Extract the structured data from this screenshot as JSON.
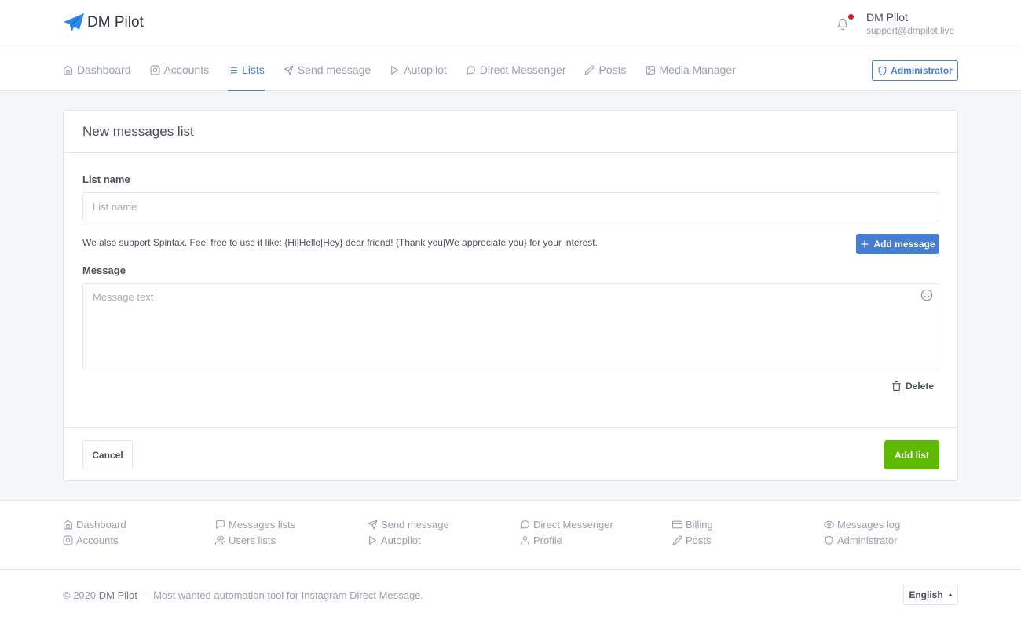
{
  "header": {
    "brand": "DM Pilot",
    "user_name": "DM Pilot",
    "user_email": "support@dmpilot.live",
    "accent": "#467fcf",
    "notification_dot_color": "#cd201f"
  },
  "nav": {
    "items": [
      {
        "label": "Dashboard",
        "icon": "home-icon",
        "active": false
      },
      {
        "label": "Accounts",
        "icon": "instagram-icon",
        "active": false
      },
      {
        "label": "Lists",
        "icon": "list-icon",
        "active": true
      },
      {
        "label": "Send message",
        "icon": "send-icon",
        "active": false
      },
      {
        "label": "Autopilot",
        "icon": "play-icon",
        "active": false
      },
      {
        "label": "Direct Messenger",
        "icon": "message-circle-icon",
        "active": false
      },
      {
        "label": "Posts",
        "icon": "edit-icon",
        "active": false
      },
      {
        "label": "Media Manager",
        "icon": "image-icon",
        "active": false
      }
    ],
    "admin_label": "Administrator"
  },
  "form": {
    "title": "New messages list",
    "list_name_label": "List name",
    "list_name_placeholder": "List name",
    "list_name_value": "",
    "spintax_hint": "We also support Spintax. Feel free to use it like: {Hi|Hello|Hey} dear friend! {Thank you|We appreciate you} for your interest.",
    "add_message_label": "Add message",
    "message_label": "Message",
    "message_placeholder": "Message text",
    "message_value": "",
    "delete_label": "Delete",
    "cancel_label": "Cancel",
    "submit_label": "Add list",
    "submit_color": "#5eba00"
  },
  "footer": {
    "columns": [
      [
        {
          "label": "Dashboard",
          "icon": "home-icon"
        },
        {
          "label": "Accounts",
          "icon": "instagram-icon"
        }
      ],
      [
        {
          "label": "Messages lists",
          "icon": "message-square-icon"
        },
        {
          "label": "Users lists",
          "icon": "users-icon"
        }
      ],
      [
        {
          "label": "Send message",
          "icon": "send-icon"
        },
        {
          "label": "Autopilot",
          "icon": "play-icon"
        }
      ],
      [
        {
          "label": "Direct Messenger",
          "icon": "message-circle-icon"
        },
        {
          "label": "Profile",
          "icon": "user-icon"
        }
      ],
      [
        {
          "label": "Billing",
          "icon": "credit-card-icon"
        },
        {
          "label": "Posts",
          "icon": "edit-icon"
        }
      ],
      [
        {
          "label": "Messages log",
          "icon": "eye-icon"
        },
        {
          "label": "Administrator",
          "icon": "shield-icon"
        }
      ]
    ],
    "copyright_prefix": "© 2020 ",
    "copyright_brand": "DM Pilot",
    "copyright_suffix": " — Most wanted automation tool for Instagram Direct Message.",
    "language": "English"
  }
}
